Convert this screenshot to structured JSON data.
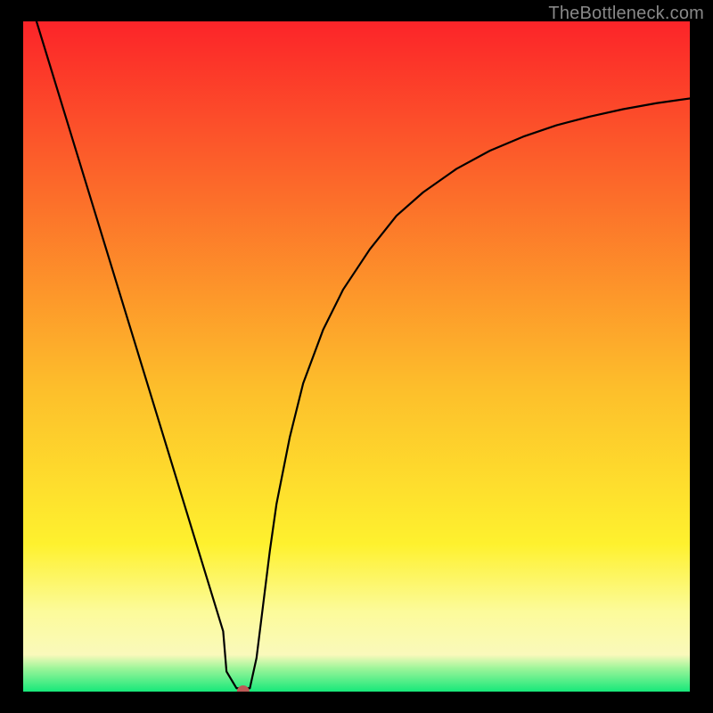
{
  "watermark": "TheBottleneck.com",
  "chart_data": {
    "type": "line",
    "title": "",
    "xlabel": "",
    "ylabel": "",
    "xlim": [
      0,
      100
    ],
    "ylim": [
      0,
      100
    ],
    "background_gradient": {
      "top": "#fc2429",
      "mid": "#fede2c",
      "band": "#fbfaa6",
      "bottom": "#17e87a"
    },
    "series": [
      {
        "name": "curve",
        "color": "#000000",
        "x": [
          2,
          4,
          6,
          8,
          10,
          12,
          14,
          16,
          18,
          20,
          22,
          24,
          26,
          28,
          30,
          30.5,
          32,
          34,
          35,
          36,
          37,
          38,
          40,
          42,
          45,
          48,
          52,
          56,
          60,
          65,
          70,
          75,
          80,
          85,
          90,
          95,
          100
        ],
        "values": [
          100,
          93.5,
          87,
          80.5,
          74,
          67.5,
          61,
          54.5,
          48,
          41.5,
          35,
          28.5,
          22,
          15.5,
          9,
          3,
          0.5,
          0.5,
          5,
          13,
          21,
          28,
          38,
          46,
          54,
          60,
          66,
          71,
          74.5,
          78,
          80.7,
          82.8,
          84.5,
          85.8,
          86.9,
          87.8,
          88.5
        ]
      }
    ],
    "marker": {
      "name": "optimum-point",
      "color": "#bd5a56",
      "x": 33,
      "y": 0,
      "size": 7
    }
  }
}
